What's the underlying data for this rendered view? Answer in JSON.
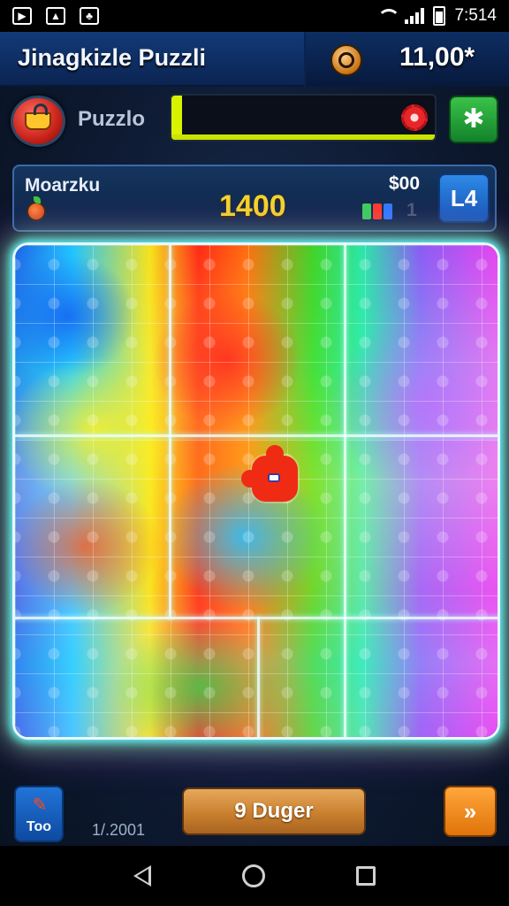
{
  "status_bar": {
    "time": "7:514"
  },
  "header": {
    "title": "Jinagkizle Puzzli",
    "coins": "11,00*"
  },
  "toolbar": {
    "mode_label": "Puzzlo",
    "progress_fraction": 0.04
  },
  "info": {
    "player": "Moarzku",
    "score": "1400",
    "bet": "$00",
    "gems": "1",
    "level": "L4"
  },
  "bottom": {
    "tool_label": "Too",
    "piece_counter": "1/.2001",
    "main_button": "9 Duger",
    "next_symbol": "»"
  },
  "colors": {
    "board_glow": "#5ff4ff",
    "accent_gold": "#f5d52a",
    "progress": "#d9f200"
  },
  "icons": [
    "basket-icon",
    "gear-icon",
    "puzzle-icon",
    "fruit-icon",
    "gems-icon",
    "coin-icon",
    "hammer-icon"
  ]
}
